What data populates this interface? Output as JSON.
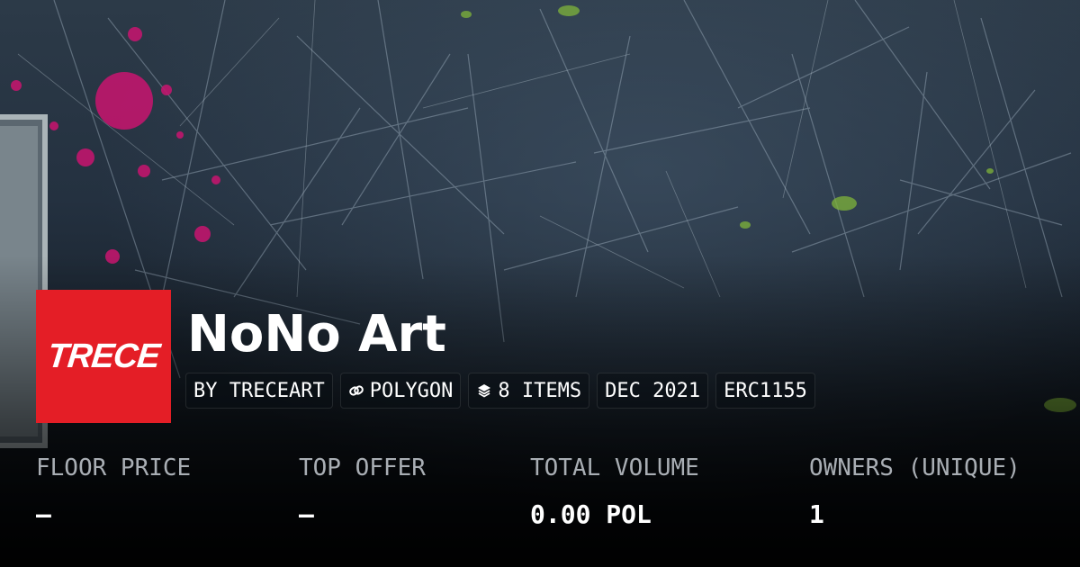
{
  "collection": {
    "title": "NoNo Art",
    "logo_text": "TRECE",
    "logo_color": "#e41e26",
    "chips": [
      {
        "label": "BY TRECEART",
        "icon": ""
      },
      {
        "label": "POLYGON",
        "icon": "link-icon"
      },
      {
        "label": "8 ITEMS",
        "icon": "layers-icon"
      },
      {
        "label": "DEC 2021",
        "icon": ""
      },
      {
        "label": "ERC1155",
        "icon": ""
      }
    ]
  },
  "stats": [
    {
      "label": "FLOOR PRICE",
      "value": "–"
    },
    {
      "label": "TOP OFFER",
      "value": "–"
    },
    {
      "label": "TOTAL VOLUME",
      "value": "0.00 POL"
    },
    {
      "label": "OWNERS (UNIQUE)",
      "value": "1"
    }
  ]
}
